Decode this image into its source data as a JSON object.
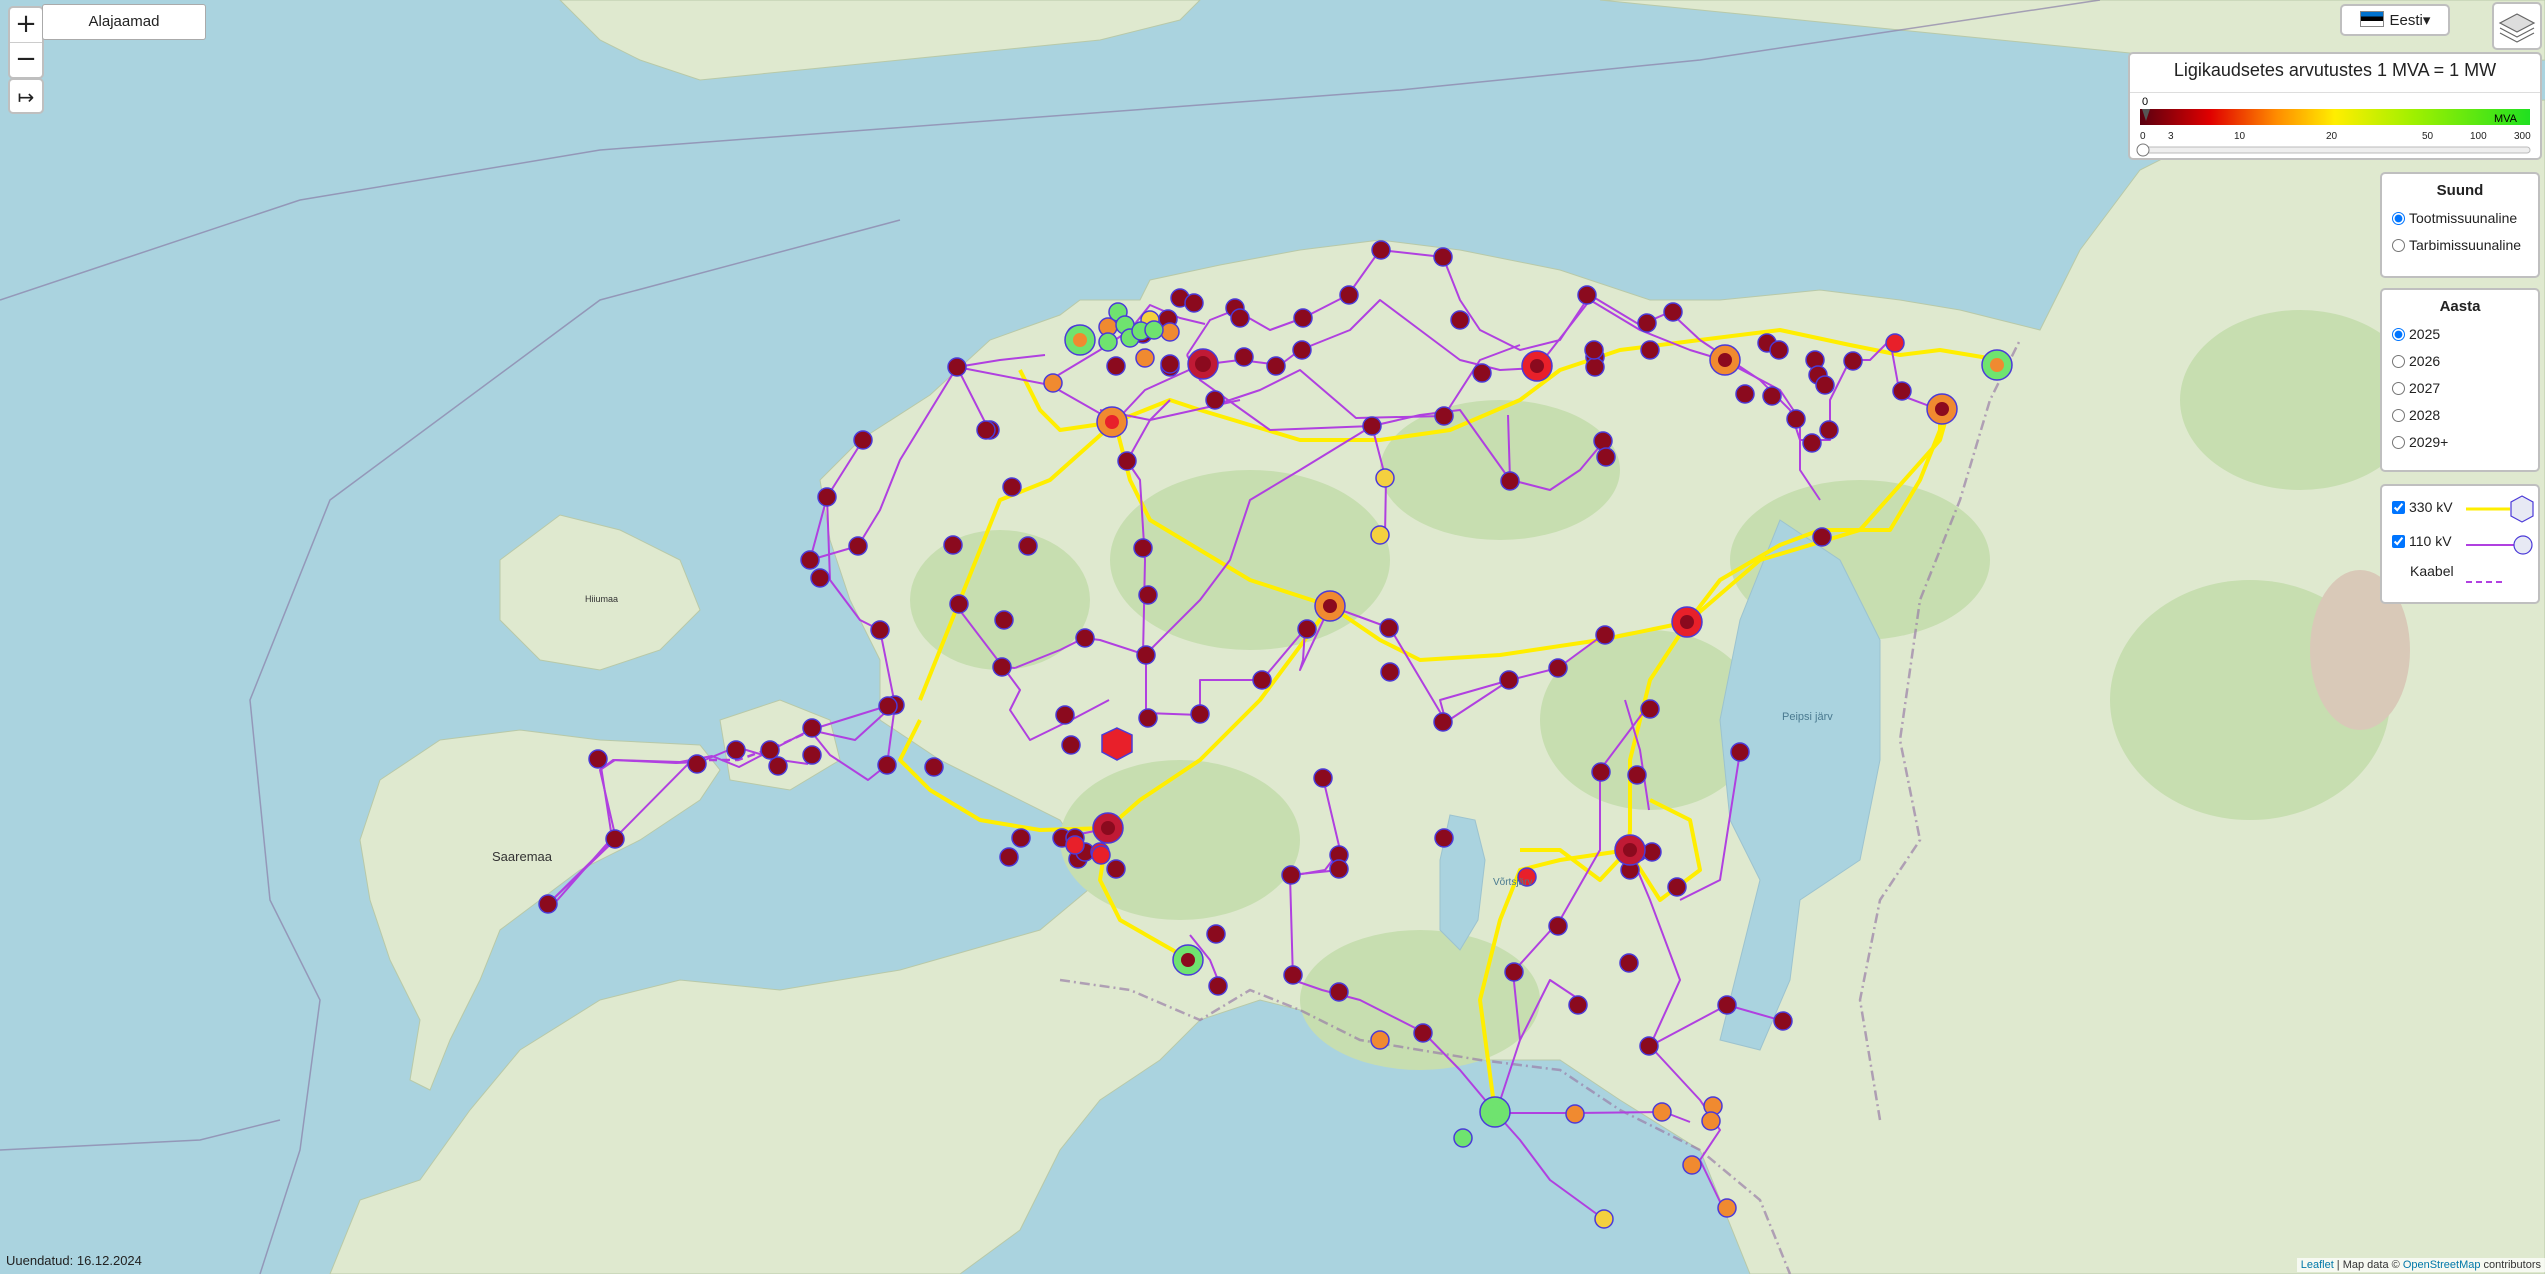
{
  "search": {
    "label": "Alajaamad"
  },
  "zoom": {
    "in": "+",
    "out": "−"
  },
  "expand": {
    "icon": "↦"
  },
  "language": {
    "label": "Eesti",
    "caret": "▾"
  },
  "legend": {
    "title": "Ligikaudsetes arvutustes 1 MVA = 1 MW",
    "scale_start": "0",
    "unit": "MVA",
    "ticks": [
      "0",
      "3",
      "10",
      "20",
      "50",
      "100",
      "300"
    ]
  },
  "direction": {
    "title": "Suund",
    "options": [
      "Tootmissuunaline",
      "Tarbimissuunaline"
    ],
    "selected": "Tootmissuunaline"
  },
  "year": {
    "title": "Aasta",
    "options": [
      "2025",
      "2026",
      "2027",
      "2028",
      "2029+"
    ],
    "selected": "2025"
  },
  "lines": {
    "kv330": "330 kV",
    "kv110": "110 kV",
    "cable": "Kaabel",
    "color_330": "#ffee00",
    "color_110": "#b040e0"
  },
  "updated": "Uuendatud: 16.12.2024",
  "attribution": {
    "leaflet": "Leaflet",
    "sep": " | Map data © ",
    "osm": "OpenStreetMap",
    "suffix": " contributors"
  },
  "places": [
    "Saaremaa",
    "Hiiumaa",
    "Peipsi järv",
    "Võrtsjärv"
  ],
  "colors": {
    "sea": "#aad3df",
    "land": "#dfe9cf",
    "forest": "#c7deb0",
    "dark_red": "#8b0a1e",
    "red": "#e8202a",
    "orange": "#f08a30",
    "yellow": "#f4d03f",
    "green": "#6fe36f"
  }
}
